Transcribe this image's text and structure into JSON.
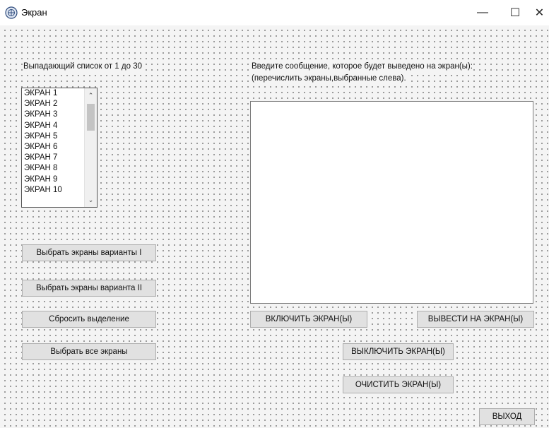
{
  "window": {
    "title": "Экран",
    "minimize_glyph": "—",
    "maximize_glyph": "☐",
    "close_glyph": "✕"
  },
  "left": {
    "list_label": "Выпадающий список от 1 до 30",
    "list_items": [
      "ЭКРАН 1",
      "ЭКРАН 2",
      "ЭКРАН 3",
      "ЭКРАН 4",
      "ЭКРАН 5",
      "ЭКРАН 6",
      "ЭКРАН 7",
      "ЭКРАН 8",
      "ЭКРАН 9",
      "ЭКРАН 10"
    ],
    "buttons": {
      "select_variant_1": "Выбрать экраны варианты I",
      "select_variant_2": "Выбрать экраны варианта II",
      "reset_selection": "Сбросить выделение",
      "select_all": "Выбрать все экраны"
    }
  },
  "right": {
    "message_label_line1": "Введите сообщение, которое будет выведено  на экран(ы):",
    "message_label_line2": "(перечислить экраны,выбранные слева).",
    "message_value": "",
    "buttons": {
      "turn_on": "ВКЛЮЧИТЬ ЭКРАН(Ы)",
      "output": "ВЫВЕСТИ НА ЭКРАН(Ы)",
      "turn_off": "ВЫКЛЮЧИТЬ ЭКРАН(Ы)",
      "clear": "ОЧИСТИТЬ ЭКРАН(Ы)",
      "exit": "ВЫХОД"
    }
  },
  "icons": {
    "app": "app-icon",
    "scroll_up": "chevron-up-icon",
    "scroll_down": "chevron-down-icon"
  },
  "colors": {
    "client_bg": "#f4f4f4",
    "button_bg": "#e1e1e1",
    "button_border": "#adadad",
    "grid_dot": "#8a8a8a"
  }
}
